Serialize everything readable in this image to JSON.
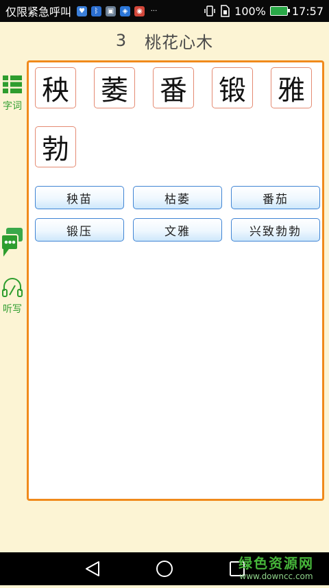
{
  "status_bar": {
    "carrier_text": "仅限紧急呼叫",
    "battery_percent": "100%",
    "time": "17:57",
    "notification_icons": [
      "health-icon",
      "bluetooth-icon",
      "gallery-icon",
      "shield-icon",
      "app-icon",
      "more-icon"
    ],
    "system_icons": [
      "vibrate-icon",
      "sim-icon",
      "battery-icon"
    ],
    "battery_color": "#29a847"
  },
  "header": {
    "lesson_number": "3",
    "lesson_title": "桃花心木"
  },
  "sidebar": {
    "items": [
      {
        "icon": "grid-list-icon",
        "label": "字词"
      },
      {
        "icon": "chat-bubble-icon",
        "label": ""
      },
      {
        "icon": "headphone-pen-icon",
        "label": "听写"
      }
    ],
    "active_color": "#2e9d2e"
  },
  "characters": [
    "秧",
    "萎",
    "番",
    "锻",
    "雅",
    "勃"
  ],
  "words": [
    "秧苗",
    "枯萎",
    "番茄",
    "锻压",
    "文雅",
    "兴致勃勃"
  ],
  "colors": {
    "panel_border": "#f08a1c",
    "char_border": "#e48a72",
    "word_border": "#3f84d4",
    "background": "#fcf4d4"
  },
  "nav_bar": {
    "buttons": [
      "back-icon",
      "home-icon",
      "recent-apps-icon"
    ]
  },
  "watermark": {
    "title": "绿色资源网",
    "url": "www.downcc.com"
  }
}
